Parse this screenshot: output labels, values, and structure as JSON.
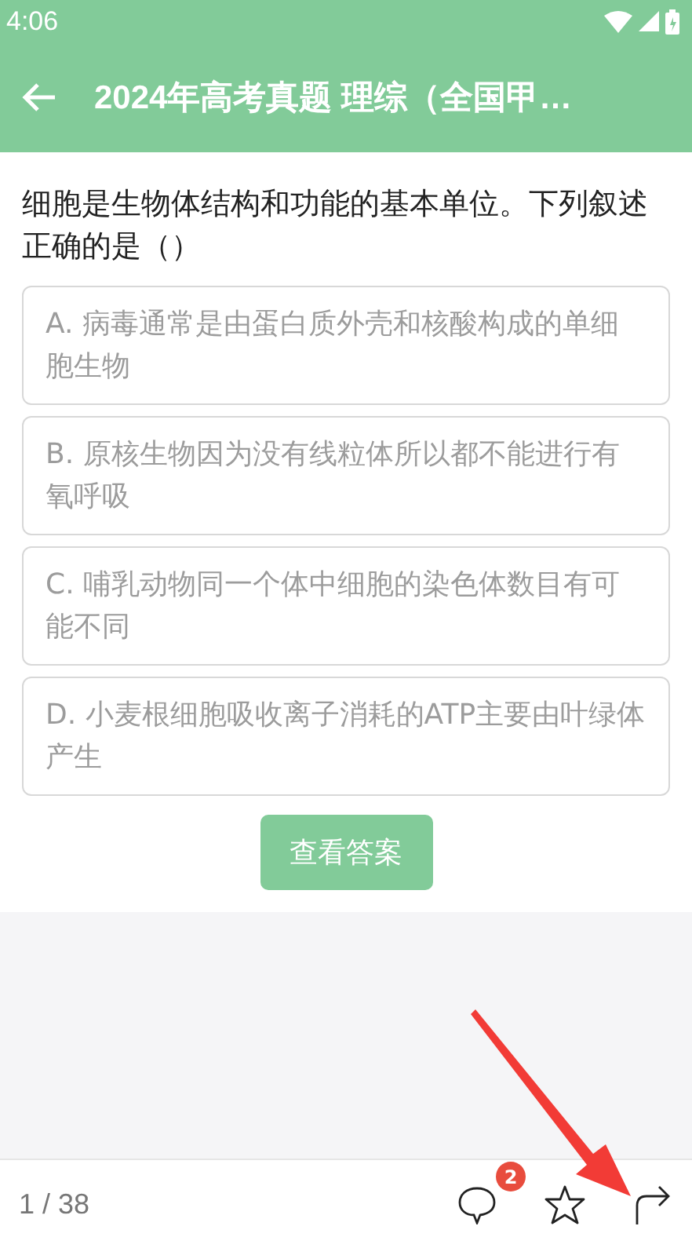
{
  "status_bar": {
    "time": "4:06"
  },
  "header": {
    "title": "2024年高考真题 理综（全国甲…"
  },
  "question": {
    "text": "细胞是生物体结构和功能的基本单位。下列叙述正确的是（）",
    "options": [
      {
        "text": "A. 病毒通常是由蛋白质外壳和核酸构成的单细胞生物"
      },
      {
        "text": "B. 原核生物因为没有线粒体所以都不能进行有氧呼吸"
      },
      {
        "text": "C. 哺乳动物同一个体中细胞的染色体数目有可能不同"
      },
      {
        "text": "D. 小麦根细胞吸收离子消耗的ATP主要由叶绿体产生"
      }
    ],
    "answer_button": "查看答案"
  },
  "bottom_bar": {
    "page": "1 / 38",
    "comment_count": "2"
  }
}
